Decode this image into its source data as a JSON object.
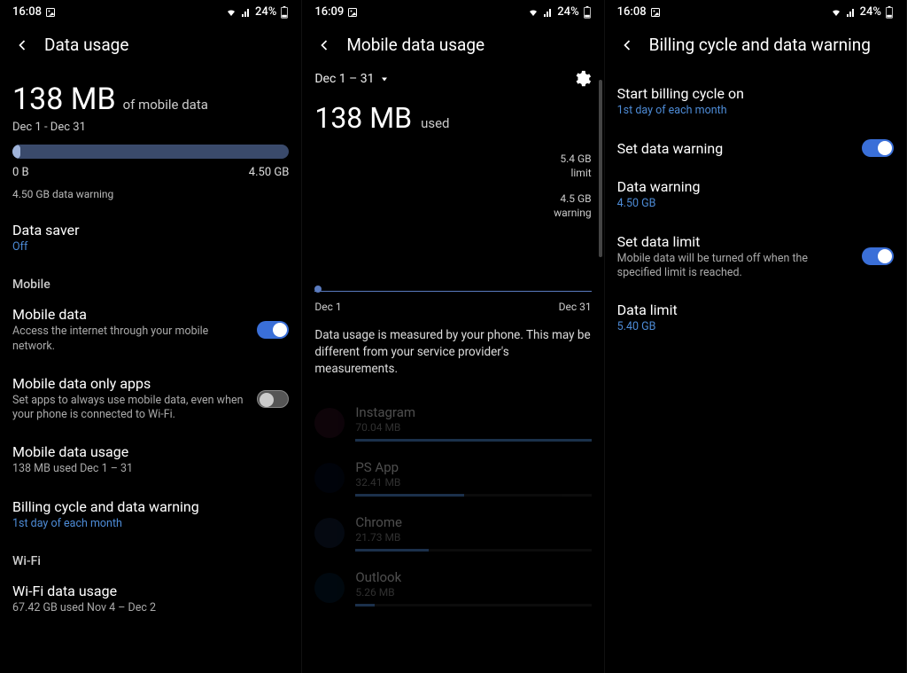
{
  "status": {
    "time_a": "16:08",
    "time_b": "16:09",
    "time_c": "16:08",
    "battery": "24%"
  },
  "panel1": {
    "title": "Data usage",
    "big_value": "138 MB",
    "big_suffix": "of mobile data",
    "date_range": "Dec 1 - Dec 31",
    "progress": {
      "min": "0 B",
      "max": "4.50 GB",
      "fill_percent": 3
    },
    "warning_text": "4.50 GB data warning",
    "data_saver": {
      "title": "Data saver",
      "value": "Off"
    },
    "mobile_section": "Mobile",
    "mobile_data": {
      "title": "Mobile data",
      "desc": "Access the internet through your mobile network.",
      "on": true
    },
    "mobile_only": {
      "title": "Mobile data only apps",
      "desc": "Set apps to always use mobile data, even when your phone is connected to Wi-Fi.",
      "on": false
    },
    "mobile_usage": {
      "title": "Mobile data usage",
      "desc": "138 MB used Dec 1 – 31"
    },
    "billing": {
      "title": "Billing cycle and data warning",
      "desc": "1st day of each month"
    },
    "wifi_section": "Wi-Fi",
    "wifi_usage": {
      "title": "Wi-Fi data usage",
      "desc": "67.42 GB used Nov 4 – Dec 2"
    }
  },
  "panel2": {
    "title": "Mobile data usage",
    "date_dropdown": "Dec 1 – 31",
    "big_value": "138 MB",
    "used_label": "used",
    "limit": {
      "value": "5.4 GB",
      "label": "limit"
    },
    "warning": {
      "value": "4.5 GB",
      "label": "warning"
    },
    "chart": {
      "start": "Dec 1",
      "end": "Dec 31"
    },
    "measure_text": "Data usage is measured by your phone. This may be different from your service provider's measurements.",
    "apps": [
      {
        "name": "Instagram",
        "mb": "70.04 MB",
        "bar": 100,
        "color": "#c13584"
      },
      {
        "name": "PS App",
        "mb": "32.41 MB",
        "bar": 46,
        "color": "#003087"
      },
      {
        "name": "Chrome",
        "mb": "21.73 MB",
        "bar": 31,
        "color": "#4285f4"
      },
      {
        "name": "Outlook",
        "mb": "5.26 MB",
        "bar": 8,
        "color": "#0078d4"
      }
    ]
  },
  "panel3": {
    "title": "Billing cycle and data warning",
    "billing_cycle": {
      "title": "Start billing cycle on",
      "value": "1st day of each month"
    },
    "set_warning": {
      "title": "Set data warning",
      "on": true
    },
    "data_warning": {
      "title": "Data warning",
      "value": "4.50 GB"
    },
    "set_limit": {
      "title": "Set data limit",
      "desc": "Mobile data will be turned off when the specified limit is reached.",
      "on": true
    },
    "data_limit": {
      "title": "Data limit",
      "value": "5.40 GB"
    }
  }
}
